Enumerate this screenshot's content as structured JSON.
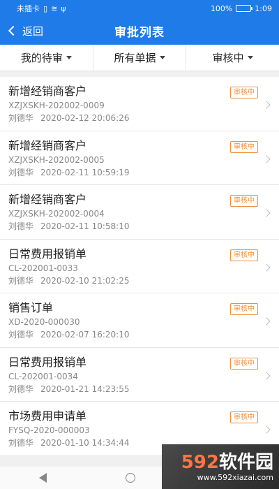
{
  "statusbar": {
    "carrier": "未插卡",
    "battery_text": "100%",
    "time": "1:09"
  },
  "navbar": {
    "back_label": "返回",
    "title": "审批列表"
  },
  "filters": [
    {
      "label": "我的待审"
    },
    {
      "label": "所有单据"
    },
    {
      "label": "审核中"
    }
  ],
  "items": [
    {
      "title": "新增经销商客户",
      "code": "XZJXSKH-202002-0009",
      "user": "刘德华",
      "time": "2020-02-12 20:06:26",
      "status": "审核中"
    },
    {
      "title": "新增经销商客户",
      "code": "XZJXSKH-202002-0005",
      "user": "刘德华",
      "time": "2020-02-11 10:59:19",
      "status": "审核中"
    },
    {
      "title": "新增经销商客户",
      "code": "XZJXSKH-202002-0004",
      "user": "刘德华",
      "time": "2020-02-11 10:58:10",
      "status": "审核中"
    },
    {
      "title": "日常费用报销单",
      "code": "CL-202001-0033",
      "user": "刘德华",
      "time": "2020-02-10 21:02:25",
      "status": "审核中"
    },
    {
      "title": "销售订单",
      "code": "XD-2020-000030",
      "user": "刘德华",
      "time": "2020-02-07 16:20:10",
      "status": "审核中"
    },
    {
      "title": "日常费用报销单",
      "code": "CL-202001-0034",
      "user": "刘德华",
      "time": "2020-01-21 14:23:55",
      "status": "审核中"
    },
    {
      "title": "市场费用申请单",
      "code": "FYSQ-2020-000003",
      "user": "刘德华",
      "time": "2020-01-10 14:34:44",
      "status": "审核中"
    }
  ],
  "watermark": {
    "main_num": "592",
    "main_text": "软件园",
    "url": "www.592xiazai.com"
  },
  "colors": {
    "primary": "#1e7be8",
    "badge": "#f0903a"
  }
}
